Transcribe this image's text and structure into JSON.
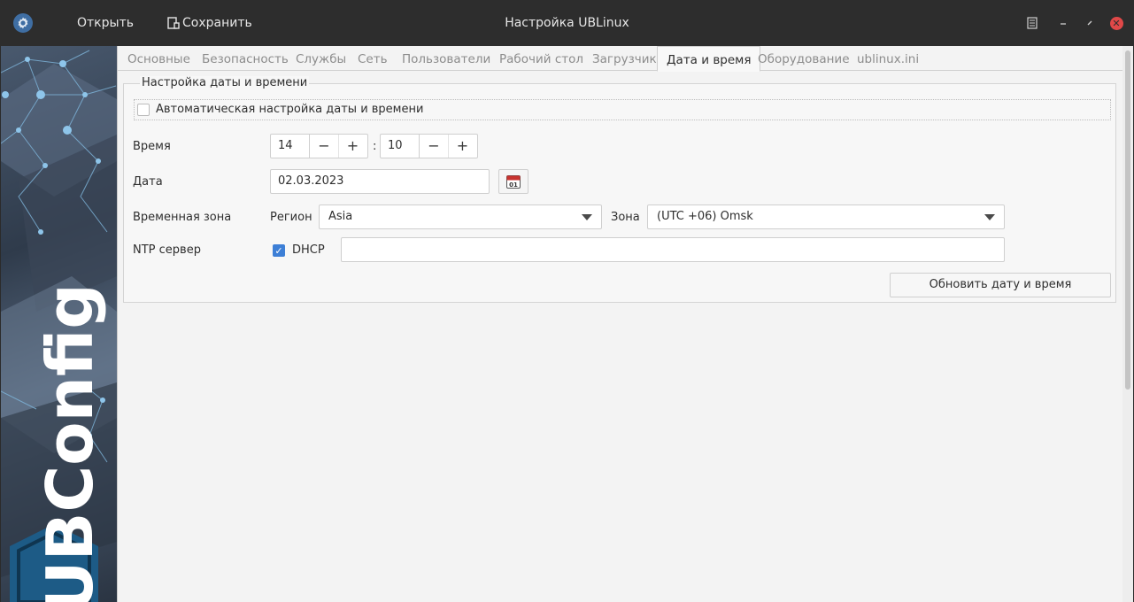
{
  "titlebar": {
    "open_label": "Открыть",
    "save_label": "Сохранить",
    "title": "Настройка UBLinux"
  },
  "tabs": [
    {
      "label": "Основные",
      "active": false
    },
    {
      "label": "Безопасность",
      "active": false
    },
    {
      "label": "Службы",
      "active": false
    },
    {
      "label": "Сеть",
      "active": false
    },
    {
      "label": "Пользователи",
      "active": false
    },
    {
      "label": "Рабочий стол",
      "active": false
    },
    {
      "label": "Загрузчик",
      "active": false
    },
    {
      "label": "Дата и время",
      "active": true
    },
    {
      "label": "Оборудование",
      "active": false
    },
    {
      "label": "ublinux.ini",
      "active": false
    }
  ],
  "datetime": {
    "frame_title": "Настройка даты и времени",
    "auto_label": "Автоматическая настройка даты и времени",
    "auto_checked": false,
    "time_label": "Время",
    "hours": "14",
    "minutes": "10",
    "separator": ":",
    "date_label": "Дата",
    "date_value": "02.03.2023",
    "calendar_day": "01",
    "timezone_label": "Временная зона",
    "region_label": "Регион",
    "region_value": "Asia",
    "zone_label": "Зона",
    "zone_value": "(UTC +06) Omsk",
    "ntp_label": "NTP сервер",
    "dhcp_label": "DHCP",
    "dhcp_checked": true,
    "ntp_value": "",
    "update_button": "Обновить дату и время"
  },
  "banner": {
    "logo_text": "UBConfig"
  },
  "colors": {
    "accent": "#3d7fd6",
    "titlebar": "#2d2d2d",
    "close": "#e04848",
    "calendar_red": "#c8332f"
  }
}
